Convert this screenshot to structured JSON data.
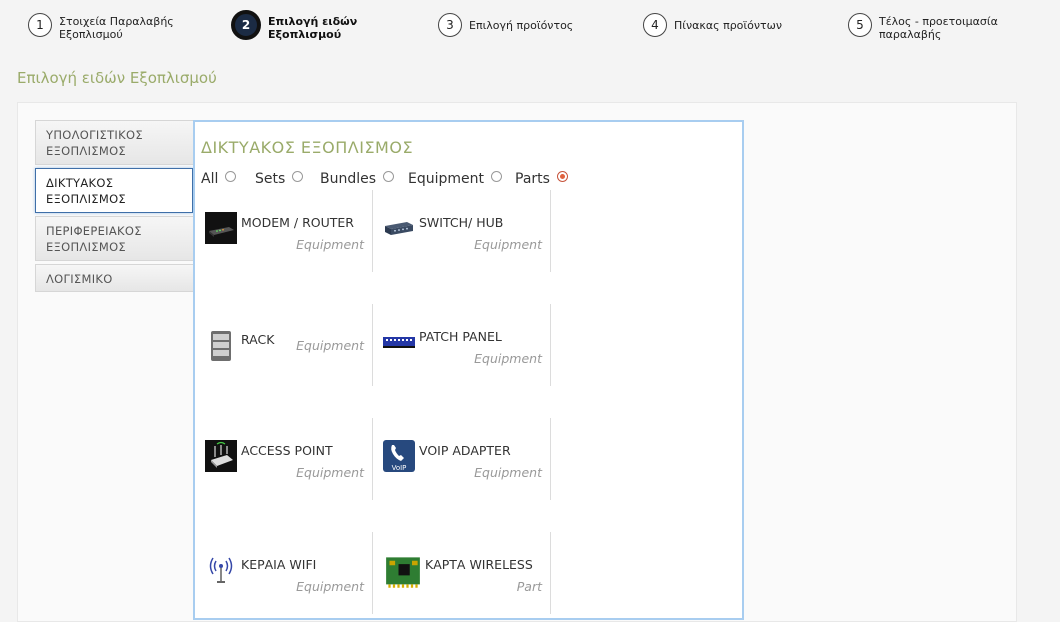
{
  "stepper": [
    {
      "number": "1",
      "label": "Στοιχεία Παραλαβής Εξοπλισμού"
    },
    {
      "number": "2",
      "label": "Επιλογή ειδών Εξοπλισμού"
    },
    {
      "number": "3",
      "label": "Επιλογή προϊόντος"
    },
    {
      "number": "4",
      "label": "Πίνακας προϊόντων"
    },
    {
      "number": "5",
      "label": "Τέλος - προετοιμασία παραλαβής"
    }
  ],
  "page_title": "Επιλογή ειδών Εξοπλισμού",
  "sidebar": [
    {
      "label": "ΥΠΟΛΟΓΙΣΤΙΚΟΣ ΕΞΟΠΛΙΣΜΟΣ"
    },
    {
      "label": "ΔΙΚΤΥΑΚΟΣ ΕΞΟΠΛΙΣΜΟΣ"
    },
    {
      "label": "ΠΕΡΙΦΕΡΕΙΑΚΟΣ ΕΞΟΠΛΙΣΜΟΣ"
    },
    {
      "label": "ΛΟΓΙΣΜΙΚΟ"
    }
  ],
  "content_title": "ΔΙΚΤΥΑΚΟΣ ΕΞΟΠΛΙΣΜΟΣ",
  "filters": [
    {
      "label": "All",
      "checked": false
    },
    {
      "label": "Sets",
      "checked": false
    },
    {
      "label": "Bundles",
      "checked": false
    },
    {
      "label": "Equipment",
      "checked": false
    },
    {
      "label": "Parts",
      "checked": true
    }
  ],
  "products": [
    {
      "name": "MODEM / ROUTER",
      "kind": "Equipment",
      "icon": "modem-router-icon"
    },
    {
      "name": "SWITCH/ HUB",
      "kind": "Equipment",
      "icon": "switch-hub-icon"
    },
    {
      "name": "RACK",
      "kind": "Equipment",
      "icon": "rack-icon"
    },
    {
      "name": "PATCH PANEL",
      "kind": "Equipment",
      "icon": "patch-panel-icon"
    },
    {
      "name": "ACCESS POINT",
      "kind": "Equipment",
      "icon": "access-point-icon"
    },
    {
      "name": "VOIP ADAPTER",
      "kind": "Equipment",
      "icon": "voip-adapter-icon",
      "icon_text": "VoIP"
    },
    {
      "name": "ΚΕΡΑΙΑ WIFI",
      "kind": "Equipment",
      "icon": "wifi-antenna-icon"
    },
    {
      "name": "ΚΑΡΤΑ WIRELESS",
      "kind": "Part",
      "icon": "wireless-card-icon"
    }
  ],
  "colors": {
    "title_green": "#9aab6a",
    "content_border": "#a8cdf0",
    "active_tab_border": "#3f6fa8",
    "radio_checked": "#e0623f"
  }
}
